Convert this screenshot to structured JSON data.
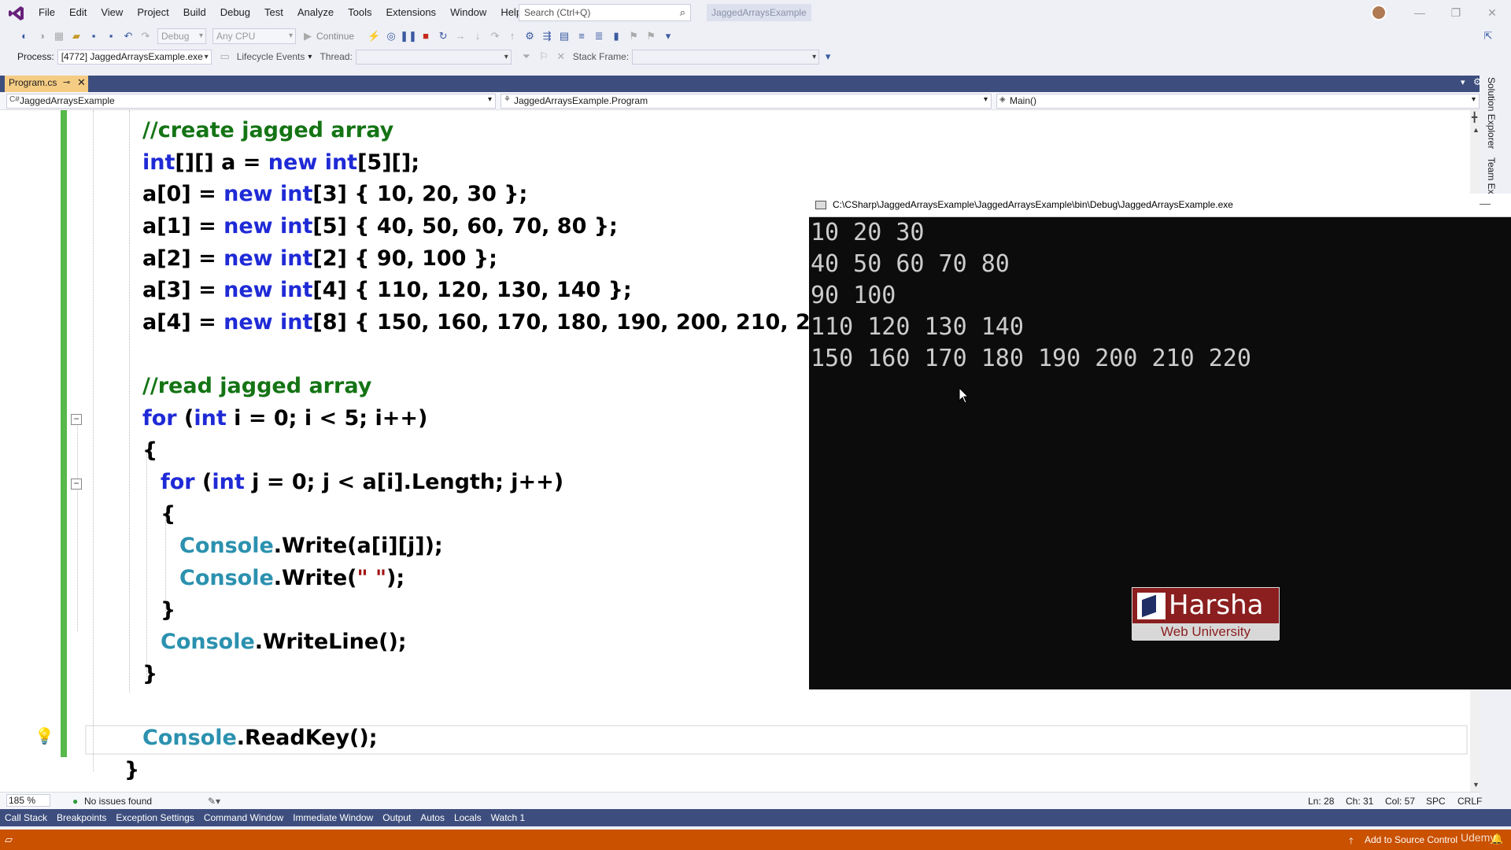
{
  "menu": [
    "File",
    "Edit",
    "View",
    "Project",
    "Build",
    "Debug",
    "Test",
    "Analyze",
    "Tools",
    "Extensions",
    "Window",
    "Help"
  ],
  "search": {
    "placeholder": "Search (Ctrl+Q)"
  },
  "solution_name": "JaggedArraysExample",
  "toolbar": {
    "config": "Debug",
    "platform": "Any CPU",
    "continue_label": "Continue"
  },
  "debug_toolbar": {
    "process_label": "Process:",
    "process_value": "[4772] JaggedArraysExample.exe",
    "lifecycle_label": "Lifecycle Events",
    "thread_label": "Thread:",
    "stack_frame_label": "Stack Frame:"
  },
  "doc_tab": {
    "title": "Program.cs"
  },
  "navbar": {
    "project": "JaggedArraysExample",
    "class": "JaggedArraysExample.Program",
    "member": "Main()"
  },
  "code": {
    "l1": "//create jagged array",
    "l10": "//read jagged array",
    "readkey": "ReadKey();"
  },
  "console": {
    "title": "C:\\CSharp\\JaggedArraysExample\\JaggedArraysExample\\bin\\Debug\\JaggedArraysExample.exe",
    "lines": [
      "10 20 30",
      "40 50 60 70 80",
      "90 100",
      "110 120 130 140",
      "150 160 170 180 190 200 210 220"
    ]
  },
  "watermark": {
    "name": "Harsha",
    "sub": "Web University"
  },
  "side_tabs": [
    "Solution Explorer",
    "Team Explorer"
  ],
  "editor_status": {
    "zoom": "185 %",
    "issues": "No issues found",
    "ln": "Ln: 28",
    "ch": "Ch: 31",
    "col": "Col: 57",
    "spc": "SPC",
    "crlf": "CRLF"
  },
  "tool_windows": [
    "Call Stack",
    "Breakpoints",
    "Exception Settings",
    "Command Window",
    "Immediate Window",
    "Output",
    "Autos",
    "Locals",
    "Watch 1"
  ],
  "statusbar": {
    "source_control": "Add to Source Control",
    "udemy": "Udemy"
  },
  "colors": {
    "accent": "#3d4e7e",
    "statusbar": "#ca5100",
    "keyword": "#1f2ad6",
    "comment": "#147414",
    "type": "#2b91af"
  }
}
